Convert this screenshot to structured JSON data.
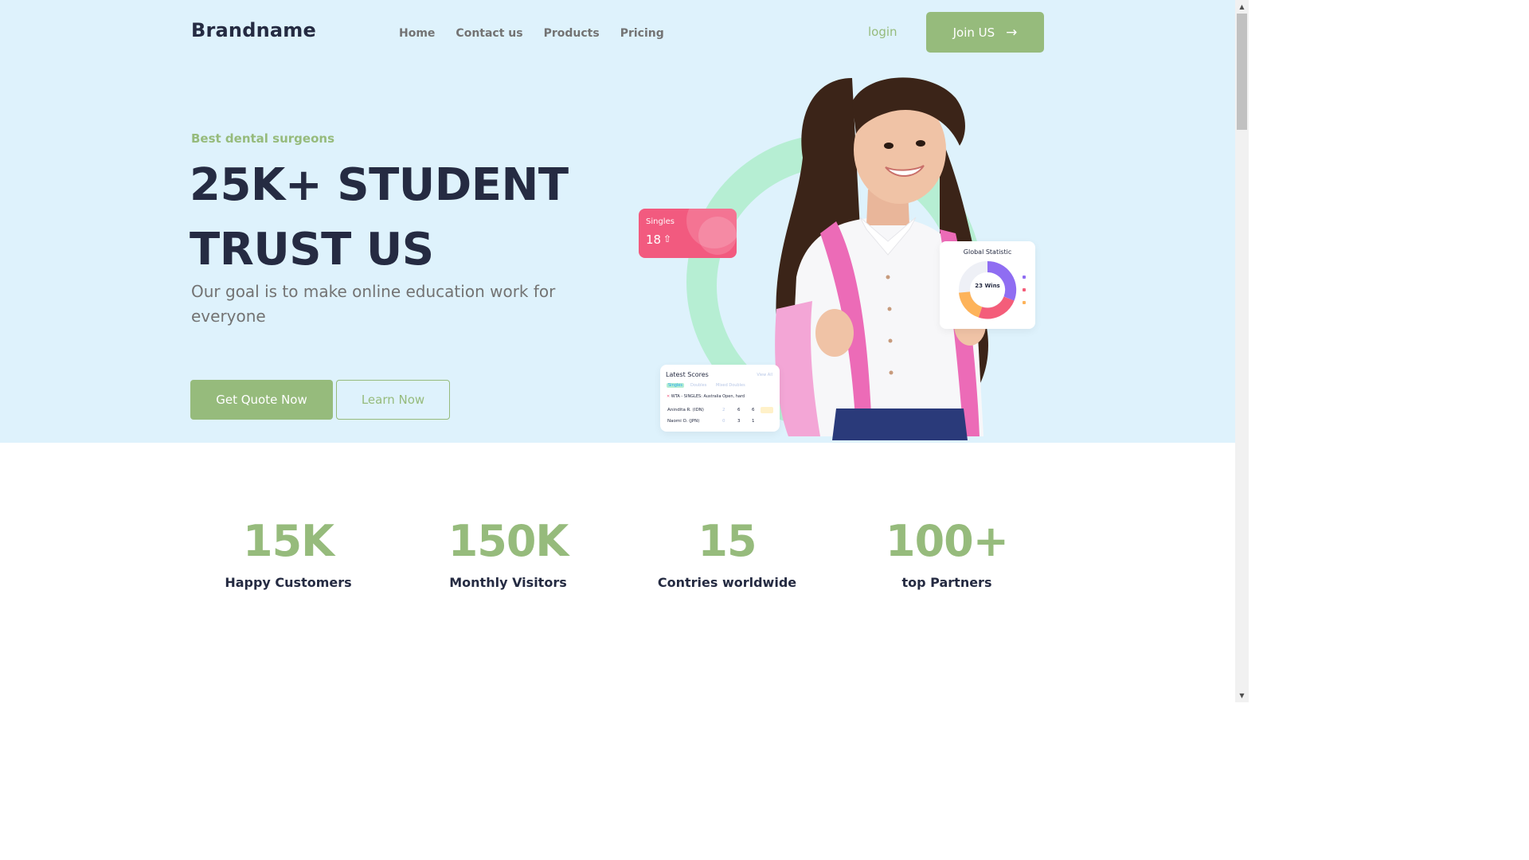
{
  "header": {
    "brand": "Brandname",
    "nav": [
      "Home",
      "Contact us",
      "Products",
      "Pricing"
    ],
    "login_label": "login",
    "join_label": "Join US",
    "join_icon": "arrow-right-icon"
  },
  "hero": {
    "kicker": "Best dental surgeons",
    "headline_line1": "25K+ STUDENT",
    "headline_line2": "TRUST US",
    "subtitle": "Our goal is to make online education work for everyone",
    "primary_button": "Get Quote Now",
    "secondary_button": "Learn Now"
  },
  "illustration": {
    "singles_card": {
      "label": "Singles",
      "value": "18",
      "trend_icon": "arrow-up-icon"
    },
    "statistic_card": {
      "title": "Global Statistic",
      "center_label": "23 Wins"
    },
    "scores_card": {
      "title": "Latest Scores",
      "view_all": "View All",
      "tabs": [
        "Singles",
        "Doubles",
        "Mixed Doubles"
      ],
      "event": "WTA - SINGLES: Australia Open, hard",
      "rows": [
        {
          "player": "Anindita R. (IDN)",
          "scores": [
            "2",
            "6",
            "6"
          ]
        },
        {
          "player": "Naomi O. (JPN)",
          "scores": [
            "0",
            "3",
            "1"
          ]
        }
      ]
    }
  },
  "stats": [
    {
      "value": "15K",
      "label": "Happy Customers"
    },
    {
      "value": "150K",
      "label": "Monthly Visitors"
    },
    {
      "value": "15",
      "label": "Contries worldwide"
    },
    {
      "value": "100+",
      "label": "top Partners"
    }
  ],
  "colors": {
    "accent_green": "#96BB7C",
    "hero_bg": "#DEF2FC",
    "dark_text": "#252B42",
    "muted_text": "#737373",
    "ring_green": "#B6EED3",
    "pink": "#F25A7F"
  }
}
